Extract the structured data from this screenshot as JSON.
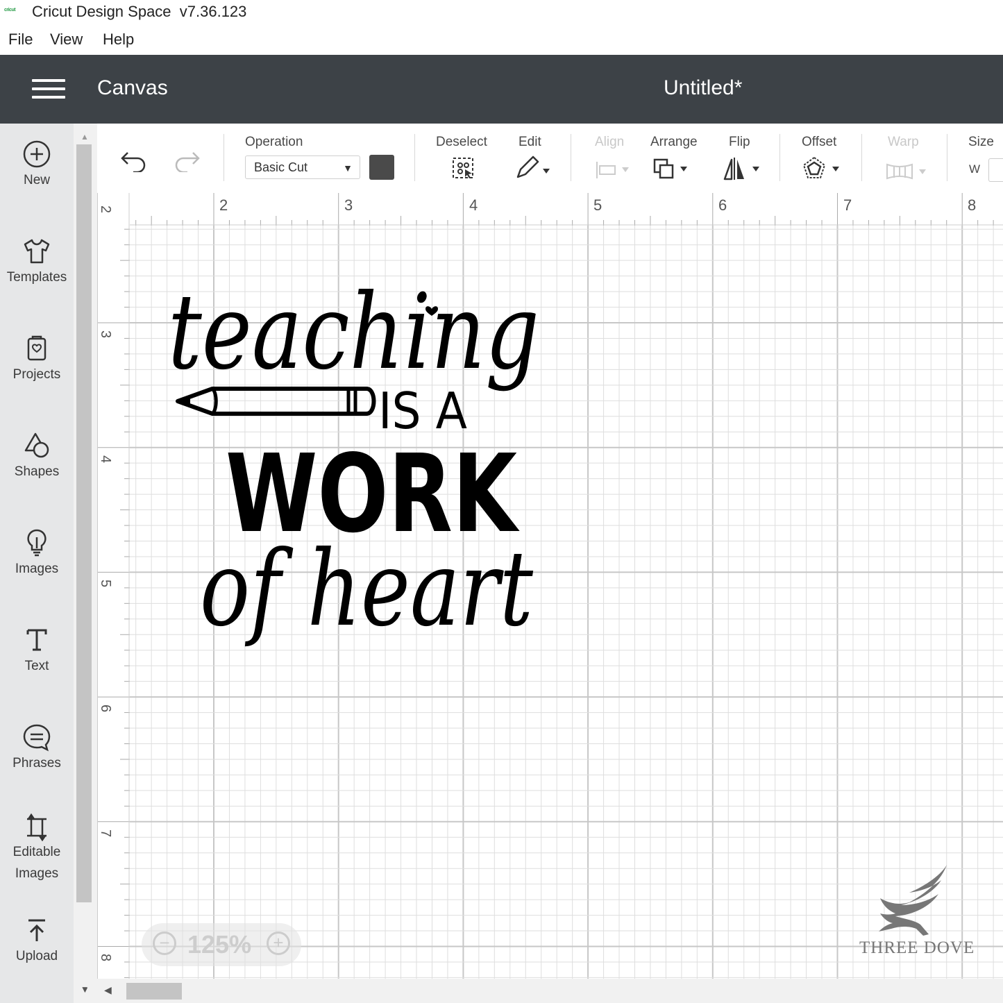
{
  "window": {
    "title": "Cricut Design Space  v7.36.123",
    "logo_text": "cricut"
  },
  "menu": {
    "items": [
      "File",
      "View",
      "Help"
    ]
  },
  "header": {
    "section": "Canvas",
    "document_title": "Untitled*",
    "background_color": "#3d4247"
  },
  "sidebar": {
    "items": [
      {
        "label": "New",
        "icon": "plus-circle-icon"
      },
      {
        "label": "Templates",
        "icon": "tshirt-icon"
      },
      {
        "label": "Projects",
        "icon": "projects-icon"
      },
      {
        "label": "Shapes",
        "icon": "shapes-icon"
      },
      {
        "label": "Images",
        "icon": "lightbulb-icon"
      },
      {
        "label": "Text",
        "icon": "text-icon"
      },
      {
        "label": "Phrases",
        "icon": "speech-bubble-icon"
      },
      {
        "label": "Editable Images",
        "icon": "editable-images-icon"
      },
      {
        "label": "Upload",
        "icon": "upload-icon"
      }
    ]
  },
  "toolbar": {
    "operation_label": "Operation",
    "operation_value": "Basic Cut",
    "operation_color": "#4a4a4a",
    "deselect_label": "Deselect",
    "edit_label": "Edit",
    "align_label": "Align",
    "arrange_label": "Arrange",
    "flip_label": "Flip",
    "offset_label": "Offset",
    "warp_label": "Warp",
    "size_label": "Size",
    "size_w_label": "W"
  },
  "ruler": {
    "top_numbers": [
      "2",
      "3",
      "4",
      "5",
      "6",
      "7",
      "8"
    ],
    "left_numbers": [
      "2",
      "3",
      "4",
      "5",
      "6",
      "7",
      "8"
    ]
  },
  "zoom": {
    "value": "125%"
  },
  "design": {
    "line1": "teaching",
    "line2": "IS A",
    "line3": "WORK",
    "line4": "of heart"
  },
  "watermark": {
    "text": "THREE DOVE"
  }
}
